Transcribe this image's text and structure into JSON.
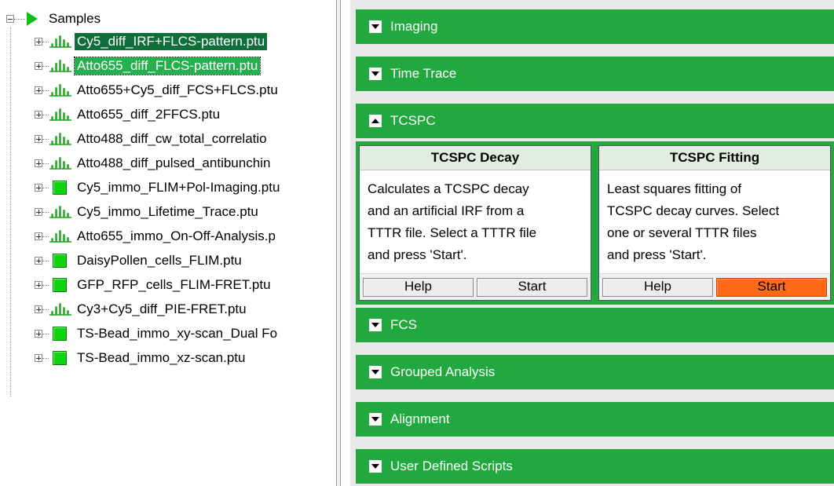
{
  "tree": {
    "root_label": "Samples",
    "items": [
      {
        "label": "Cy5_diff_IRF+FLCS-pattern.ptu",
        "icon": "pulse-trace-icon",
        "state": "selected"
      },
      {
        "label": "Atto655_diff_FLCS-pattern.ptu",
        "icon": "pulse-trace-icon",
        "state": "selected-focus"
      },
      {
        "label": "Atto655+Cy5_diff_FCS+FLCS.ptu",
        "icon": "pulse-trace-icon",
        "state": ""
      },
      {
        "label": "Atto655_diff_2FFCS.ptu",
        "icon": "pulse-trace-icon",
        "state": ""
      },
      {
        "label": "Atto488_diff_cw_total_correlatio",
        "icon": "pulse-trace-icon",
        "state": ""
      },
      {
        "label": "Atto488_diff_pulsed_antibunchin",
        "icon": "pulse-trace-icon",
        "state": ""
      },
      {
        "label": "Cy5_immo_FLIM+Pol-Imaging.ptu",
        "icon": "image-square-icon",
        "state": ""
      },
      {
        "label": "Cy5_immo_Lifetime_Trace.ptu",
        "icon": "pulse-trace-icon",
        "state": ""
      },
      {
        "label": "Atto655_immo_On-Off-Analysis.p",
        "icon": "pulse-trace-icon",
        "state": ""
      },
      {
        "label": "DaisyPollen_cells_FLIM.ptu",
        "icon": "image-square-icon",
        "state": ""
      },
      {
        "label": "GFP_RFP_cells_FLIM-FRET.ptu",
        "icon": "image-square-icon",
        "state": ""
      },
      {
        "label": "Cy3+Cy5_diff_PIE-FRET.ptu",
        "icon": "pulse-trace-icon",
        "state": ""
      },
      {
        "label": "TS-Bead_immo_xy-scan_Dual Fo",
        "icon": "image-square-icon",
        "state": ""
      },
      {
        "label": "TS-Bead_immo_xz-scan.ptu",
        "icon": "image-square-icon",
        "state": ""
      }
    ]
  },
  "sections": {
    "imaging": "Imaging",
    "time_trace": "Time Trace",
    "tcspc": "TCSPC",
    "fcs": "FCS",
    "grouped": "Grouped Analysis",
    "alignment": "Alignment",
    "user_scripts": "User Defined Scripts"
  },
  "tcspc_cards": {
    "decay": {
      "title": "TCSPC Decay",
      "lines": [
        "Calculates a TCSPC decay",
        "and an artificial IRF from a",
        "TTTR file. Select a TTTR file",
        "and press 'Start'."
      ],
      "help": "Help",
      "start": "Start"
    },
    "fitting": {
      "title": "TCSPC Fitting",
      "lines": [
        "Least squares fitting of",
        "TCSPC decay curves. Select",
        "one or several TTTR files",
        "and press 'Start'."
      ],
      "help": "Help",
      "start": "Start"
    }
  },
  "colors": {
    "section_green": "#21a83f",
    "selected_dark": "#0f6e3a",
    "selected_light": "#22b14c",
    "start_orange": "#ff6a1a",
    "icon_green": "#11d411"
  }
}
